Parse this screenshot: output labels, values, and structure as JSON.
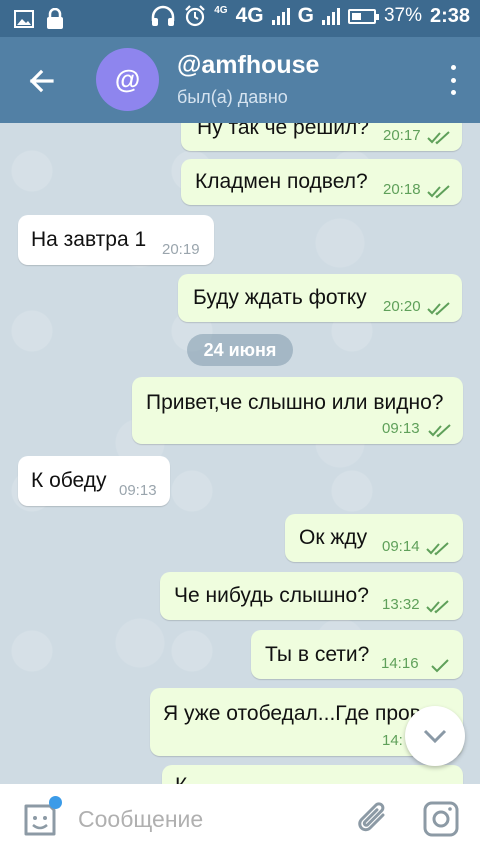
{
  "status_bar": {
    "net1": "4G",
    "net2": "G",
    "small_label": "4G",
    "battery": "37%",
    "time": "2:38"
  },
  "header": {
    "avatar_letter": "@",
    "title": "@amfhouse",
    "subtitle": "был(а) давно"
  },
  "date_separator": "24 июня",
  "messages": [
    {
      "text": "Ну так че решил?",
      "time": "20:17",
      "dir": "out",
      "read": true
    },
    {
      "text": "Кладмен подвел?",
      "time": "20:18",
      "dir": "out",
      "read": true
    },
    {
      "text": "На завтра 1",
      "time": "20:19",
      "dir": "in"
    },
    {
      "text": "Буду ждать фотку",
      "time": "20:20",
      "dir": "out",
      "read": true
    },
    {
      "text": "Привет,че слышно или видно?",
      "time": "09:13",
      "dir": "out",
      "read": true
    },
    {
      "text": "К обеду",
      "time": "09:13",
      "dir": "in"
    },
    {
      "text": "Ок жду",
      "time": "09:14",
      "dir": "out",
      "read": true
    },
    {
      "text": "Че нибудь слышно?",
      "time": "13:32",
      "dir": "out",
      "read": true
    },
    {
      "text": "Ты в сети?",
      "time": "14:16",
      "dir": "out",
      "read": false
    },
    {
      "text": "Я уже отобедал...Где прово",
      "time": "14:",
      "dir": "out"
    },
    {
      "text": "К",
      "time": "",
      "dir": "out"
    }
  ],
  "input": {
    "placeholder": "Сообщение"
  },
  "colors": {
    "header": "#5280a5",
    "status_bar": "#3d6a8f",
    "outgoing_bubble": "#effdde",
    "incoming_bubble": "#ffffff",
    "check": "#5fa05a"
  }
}
